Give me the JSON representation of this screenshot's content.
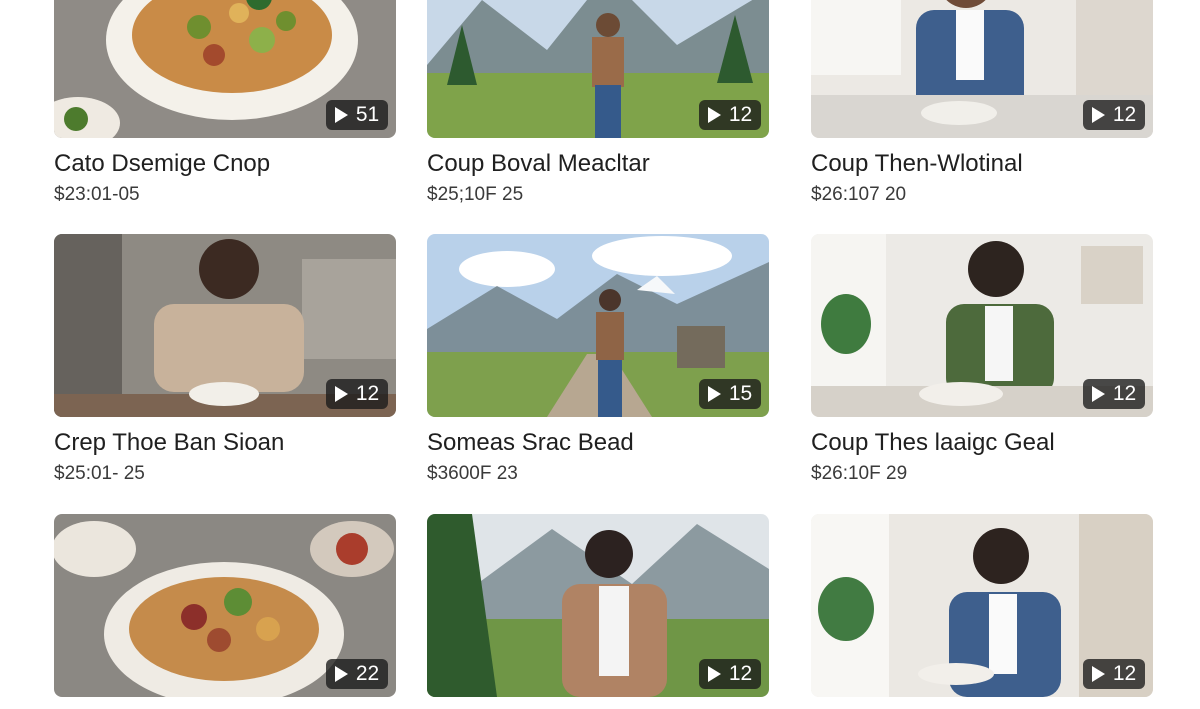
{
  "cards": [
    {
      "title": "Cato Dsemige Cnop",
      "meta": "$23:01-05",
      "count": "51",
      "scene": "food"
    },
    {
      "title": "Coup Boval Meacltar",
      "meta": "$25;10F 25",
      "count": "12",
      "scene": "mountain"
    },
    {
      "title": "Coup Then-Wlotinal",
      "meta": "$26:107 20",
      "count": "12",
      "scene": "room"
    },
    {
      "title": "Crep Thoe Ban Sioan",
      "meta": "$25:01- 25",
      "count": "12",
      "scene": "kitchen"
    },
    {
      "title": "Someas Srac Bead",
      "meta": "$3600F 23",
      "count": "15",
      "scene": "mountain"
    },
    {
      "title": "Coup Thes laaigc Geal",
      "meta": "$26:10F 29",
      "count": "12",
      "scene": "room"
    },
    {
      "title": "",
      "meta": "",
      "count": "22",
      "scene": "food"
    },
    {
      "title": "",
      "meta": "",
      "count": "12",
      "scene": "mountain"
    },
    {
      "title": "",
      "meta": "",
      "count": "12",
      "scene": "room"
    }
  ],
  "icons": {
    "badge": "play-icon"
  }
}
